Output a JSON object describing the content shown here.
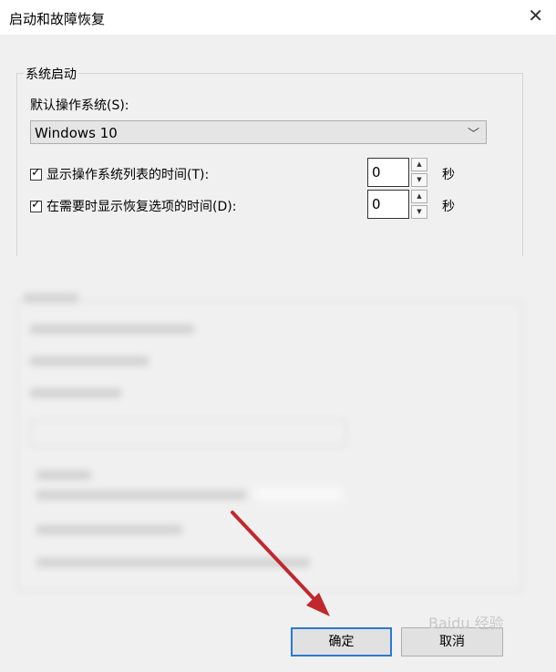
{
  "window": {
    "title": "启动和故障恢复"
  },
  "system_startup": {
    "group_label": "系统启动",
    "default_os_label": "默认操作系统(S):",
    "default_os_value": "Windows 10",
    "show_os_list": {
      "label": "显示操作系统列表的时间(T):",
      "checked": true,
      "value": "0",
      "unit": "秒"
    },
    "show_recovery": {
      "label": "在需要时显示恢复选项的时间(D):",
      "checked": true,
      "value": "0",
      "unit": "秒"
    }
  },
  "buttons": {
    "ok": "确定",
    "cancel": "取消"
  },
  "watermark": "Baidu 经验",
  "annotation": {
    "color": "#c0282d"
  }
}
